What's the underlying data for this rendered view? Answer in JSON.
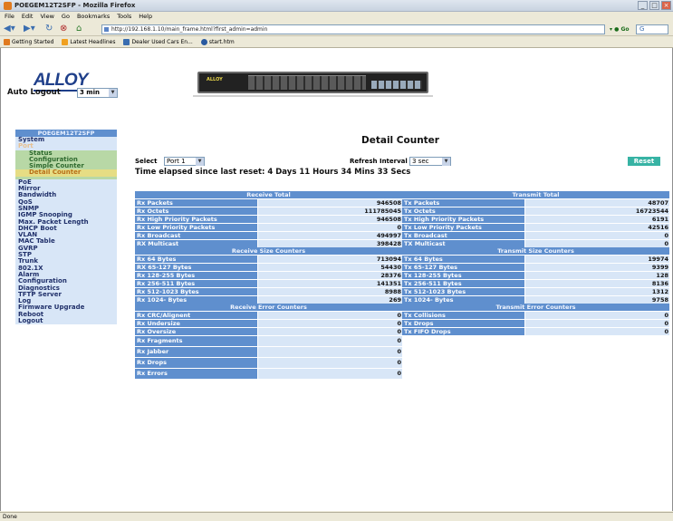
{
  "browser": {
    "title": "POEGEM12T2SFP - Mozilla Firefox",
    "menu": [
      "File",
      "Edit",
      "View",
      "Go",
      "Bookmarks",
      "Tools",
      "Help"
    ],
    "url": "http://192.168.1.10/main_frame.html?first_admin=admin",
    "go_label": "Go",
    "bookmarks": [
      "Getting Started",
      "Latest Headlines",
      "Dealer Used Cars En...",
      "start.htm"
    ],
    "status": "Done"
  },
  "header": {
    "logo_text": "ALLOY",
    "auto_logout_label": "Auto Logout",
    "auto_logout_value": "3 min",
    "device_logo": "ALLOY"
  },
  "sidebar": {
    "model": "POEGEM12T2SFP",
    "items_top": [
      "System",
      "Port"
    ],
    "port_sub": [
      "Status",
      "Configuration",
      "Simple Counter",
      "Detail Counter"
    ],
    "items": [
      "PoE",
      "Mirror",
      "Bandwidth",
      "QoS",
      "SNMP",
      "IGMP Snooping",
      "Max. Packet Length",
      "DHCP Boot",
      "VLAN",
      "MAC Table",
      "GVRP",
      "STP",
      "Trunk",
      "802.1X",
      "Alarm",
      "Configuration",
      "Diagnostics",
      "TFTP Server",
      "Log",
      "Firmware Upgrade",
      "Reboot",
      "Logout"
    ]
  },
  "main": {
    "title": "Detail Counter",
    "select_label": "Select",
    "port_value": "Port 1",
    "refresh_label": "Refresh Interval",
    "refresh_value": "3 sec",
    "reset_label": "Reset",
    "elapsed": "Time elapsed since last reset: 4 Days 11 Hours 34 Mins 33 Secs"
  },
  "receive": {
    "total_header": "Receive Total",
    "total": [
      {
        "label": "Rx Packets",
        "value": "946508"
      },
      {
        "label": "Rx Octets",
        "value": "111785045"
      },
      {
        "label": "Rx High Priority Packets",
        "value": "946508"
      },
      {
        "label": "Rx Low Priority Packets",
        "value": "0"
      },
      {
        "label": "Rx Broadcast",
        "value": "494997"
      },
      {
        "label": "RX Multicast",
        "value": "398428"
      }
    ],
    "size_header": "Receive Size Counters",
    "size": [
      {
        "label": "Rx 64 Bytes",
        "value": "713094"
      },
      {
        "label": "RX 65-127 Bytes",
        "value": "54430"
      },
      {
        "label": "Rx 128-255 Bytes",
        "value": "28376"
      },
      {
        "label": "Rx 256-511 Bytes",
        "value": "141351"
      },
      {
        "label": "Rx 512-1023 Bytes",
        "value": "8988"
      },
      {
        "label": "Rx 1024- Bytes",
        "value": "269"
      }
    ],
    "error_header": "Receive Error Counters",
    "errors": [
      {
        "label": "Rx CRC/Alignent",
        "value": "0"
      },
      {
        "label": "Rx Undersize",
        "value": "0"
      },
      {
        "label": "Rx Oversize",
        "value": "0"
      }
    ],
    "errors_tall": [
      {
        "label": "Rx Fragments",
        "value": "0"
      },
      {
        "label": "Rx Jabber",
        "value": "0"
      },
      {
        "label": "Rx Drops",
        "value": "0"
      },
      {
        "label": "Rx Errors",
        "value": "0"
      }
    ]
  },
  "transmit": {
    "total_header": "Transmit Total",
    "total": [
      {
        "label": "Tx Packets",
        "value": "48707"
      },
      {
        "label": "Tx Octets",
        "value": "16723544"
      },
      {
        "label": "Tx High Priority Packets",
        "value": "6191"
      },
      {
        "label": "Tx Low Priority Packets",
        "value": "42516"
      },
      {
        "label": "Tx Broadcast",
        "value": "0"
      },
      {
        "label": "TX Multicast",
        "value": "0"
      }
    ],
    "size_header": "Transmit Size Counters",
    "size": [
      {
        "label": "Tx 64 Bytes",
        "value": "19974"
      },
      {
        "label": "Tx 65-127 Bytes",
        "value": "9399"
      },
      {
        "label": "Tx 128-255 Bytes",
        "value": "128"
      },
      {
        "label": "Tx 256-511 Bytes",
        "value": "8136"
      },
      {
        "label": "Tx 512-1023 Bytes",
        "value": "1312"
      },
      {
        "label": "Tx 1024- Bytes",
        "value": "9758"
      }
    ],
    "error_header": "Transmit Error Counters",
    "errors": [
      {
        "label": "Tx Collisions",
        "value": "0"
      },
      {
        "label": "Tx Drops",
        "value": "0"
      },
      {
        "label": "Tx FIFO Drops",
        "value": "0"
      }
    ]
  }
}
